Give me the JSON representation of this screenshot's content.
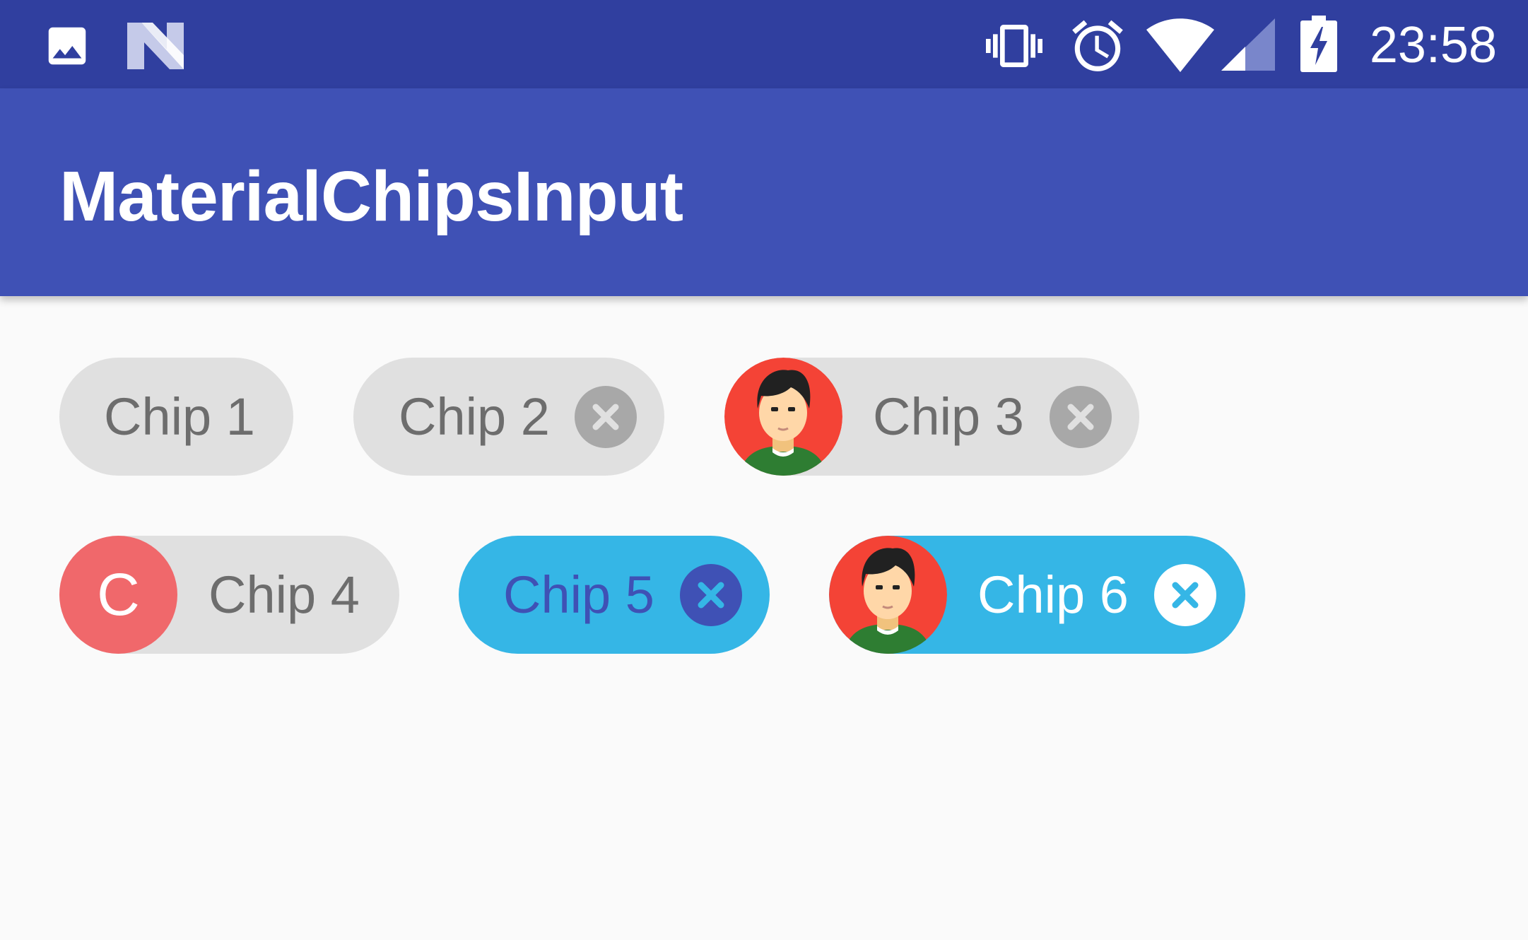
{
  "status_bar": {
    "time": "23:58",
    "left_icons": [
      "image-icon",
      "n-logo-icon"
    ],
    "right_icons": [
      "vibrate-icon",
      "alarm-icon",
      "wifi-icon",
      "signal-icon",
      "battery-charging-icon"
    ]
  },
  "app_bar": {
    "title": "MaterialChipsInput"
  },
  "chips": [
    {
      "label": "Chip 1",
      "deletable": false,
      "avatar": "none",
      "state": "default"
    },
    {
      "label": "Chip 2",
      "deletable": true,
      "avatar": "none",
      "state": "default"
    },
    {
      "label": "Chip 3",
      "deletable": true,
      "avatar": "person-avatar",
      "state": "default"
    },
    {
      "label": "Chip 4",
      "deletable": false,
      "avatar": "letter",
      "avatar_letter": "C",
      "state": "default"
    },
    {
      "label": "Chip 5",
      "deletable": true,
      "avatar": "none",
      "state": "selected"
    },
    {
      "label": "Chip 6",
      "deletable": true,
      "avatar": "person-avatar",
      "state": "selected"
    }
  ],
  "colors": {
    "status_bar": "#303f9f",
    "app_bar": "#3f51b5",
    "background": "#fafafa",
    "chip_default": "#e0e0e0",
    "chip_selected": "#35b6e6",
    "delete_default": "#a8a8a8",
    "chip5_text": "#3f51b5",
    "letter_avatar": "#f0686b",
    "avatar_bg": "#f44336"
  }
}
